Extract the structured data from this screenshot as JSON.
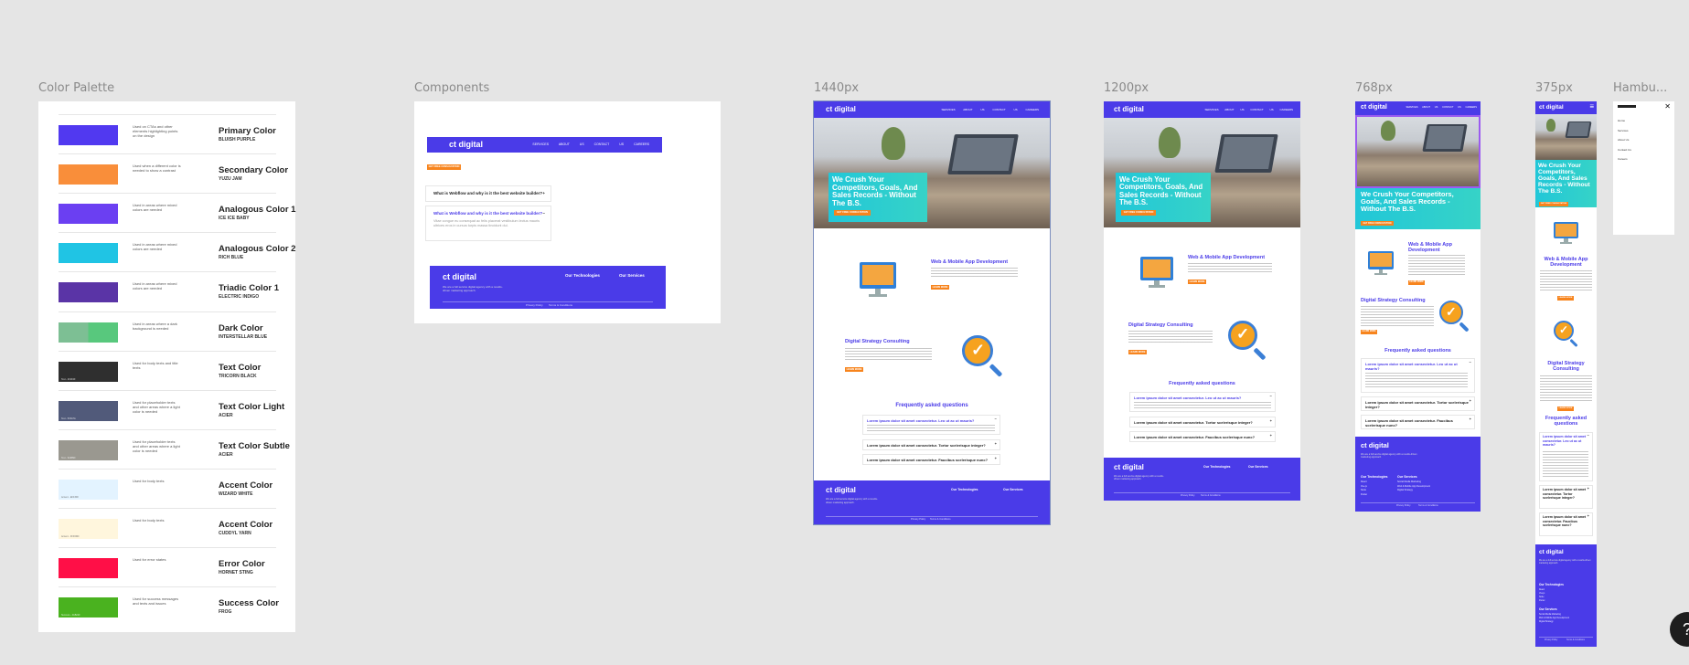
{
  "frames": {
    "color_palette": "Color Palette",
    "components": "Components",
    "w1440": "1440px",
    "w1200": "1200px",
    "w768": "768px",
    "w375": "375px",
    "hamburger": "Hambu..."
  },
  "palette": [
    {
      "desc": "Used on CTAs and other elements highlighting points on the design",
      "name": "Primary Color",
      "sub": "BLUISH PURPLE",
      "color": "#5139f0",
      "code": ""
    },
    {
      "desc": "Used when a different color is needed to show a contrast",
      "name": "Secondary Color",
      "sub": "YUZU JAM",
      "color": "#f98e3a",
      "code": ""
    },
    {
      "desc": "Used in areas where mixed colors are needed",
      "name": "Analogous Color 1",
      "sub": "ICE ICE BABY",
      "color": "#6b3ff2",
      "code": ""
    },
    {
      "desc": "Used in areas where mixed colors are needed",
      "name": "Analogous Color 2",
      "sub": "RICH BLUE",
      "color": "#20c4e4",
      "code": ""
    },
    {
      "desc": "Used in areas where mixed colors are needed",
      "name": "Triadic Color 1",
      "sub": "ELECTRIC INDIGO",
      "color": "#5a34a6",
      "code": ""
    },
    {
      "desc": "Used in areas where a dark background is needed",
      "name": "Dark Color",
      "sub": "INTERSTELLAR BLUE",
      "color": "#58c87d",
      "code": ""
    },
    {
      "desc": "Used for body texts and title texts",
      "name": "Text Color",
      "sub": "TRICORN BLACK",
      "color": "#2f2f2f",
      "code": "Text - 2F2F2F"
    },
    {
      "desc": "Used for placeholder texts and other areas where a light color is needed",
      "name": "Text Color Light",
      "sub": "ACIER",
      "color": "#515a7a",
      "code": "Text - 515A7A"
    },
    {
      "desc": "Used for placeholder texts and other areas where a light color is needed",
      "name": "Text Color Subtle",
      "sub": "ACIER",
      "color": "#9a9890",
      "code": "Text - 9A9890"
    },
    {
      "desc": "Used for body texts",
      "name": "Accent Color",
      "sub": "WIZARD WHITE",
      "color": "#e3f3ff",
      "code": "Accent - EFF3FF"
    },
    {
      "desc": "Used for body texts",
      "name": "Accent Color",
      "sub": "CUDDYL YARN",
      "color": "#fff6dd",
      "code": "Accent - FFF6DD"
    },
    {
      "desc": "Used for error states",
      "name": "Error Color",
      "sub": "HORNET STING",
      "color": "#ff0f47",
      "code": ""
    },
    {
      "desc": "Used for success messages and texts and issues",
      "name": "Success Color",
      "sub": "FROG",
      "color": "#4ab21f",
      "code": "Success - 4AB21F"
    }
  ],
  "site": {
    "logo": "ct digital",
    "nav": [
      "SERVICES",
      "ABOUT US",
      "CONTACT US",
      "CAREERS"
    ],
    "hero_title": "We Crush Your Competitors, Goals, And Sales Records - Without The B.S.",
    "hero_btn": "GET FREE CONSULTATION",
    "web_title": "Web & Mobile App Development",
    "web_text": "We build the web and mobile apps that your business needs to grow, convert and scale with confidence across every device and platform.",
    "strategy_title": "Digital Strategy Consulting",
    "strategy_text": "Your digital strategy needs to be connected to the overall business goals and the tactics you use to execute them with clarity and measurable outcomes.",
    "learn_more": "LEARN MORE",
    "faq_title": "Frequently asked questions",
    "faq": [
      "Lorem ipsum dolor sit amet consectetur. Leo ut ac ut mauris?",
      "Lorem ipsum dolor sit amet consectetur. Tortor scelerisque integer?",
      "Lorem ipsum dolor sit amet consectetur. Faucibus scelerisque nunc?"
    ],
    "footer": {
      "text": "We are a full service digital agency with a results-driven marketing approach.",
      "tech_head": "Our Technologies",
      "tech": [
        "React",
        "Vue.js",
        "Node",
        "Flutter"
      ],
      "serv_head": "Our Services",
      "serv": [
        "Social Media Marketing",
        "Web & Mobile App Development",
        "Digital Strategy"
      ],
      "privacy": "Privacy Policy",
      "terms": "Terms & Conditions"
    }
  },
  "components": {
    "badge": "GET FREE CONSULTATION",
    "faq": [
      "What is Webflow and why is it the best website builder?",
      "What is Webflow and why is it the best website builder?"
    ],
    "faq_answer": "Vitae congue eu consequat ac felis placerat vestibulum lectus mauris ultrices eros in cursus turpis massa tincidunt dui."
  },
  "hamburger_menu": [
    "Home",
    "Services",
    "About Us",
    "Contact Us",
    "Careers"
  ],
  "icons": {
    "close": "close-icon",
    "menu": "hamburger-icon",
    "help": "help-icon"
  }
}
